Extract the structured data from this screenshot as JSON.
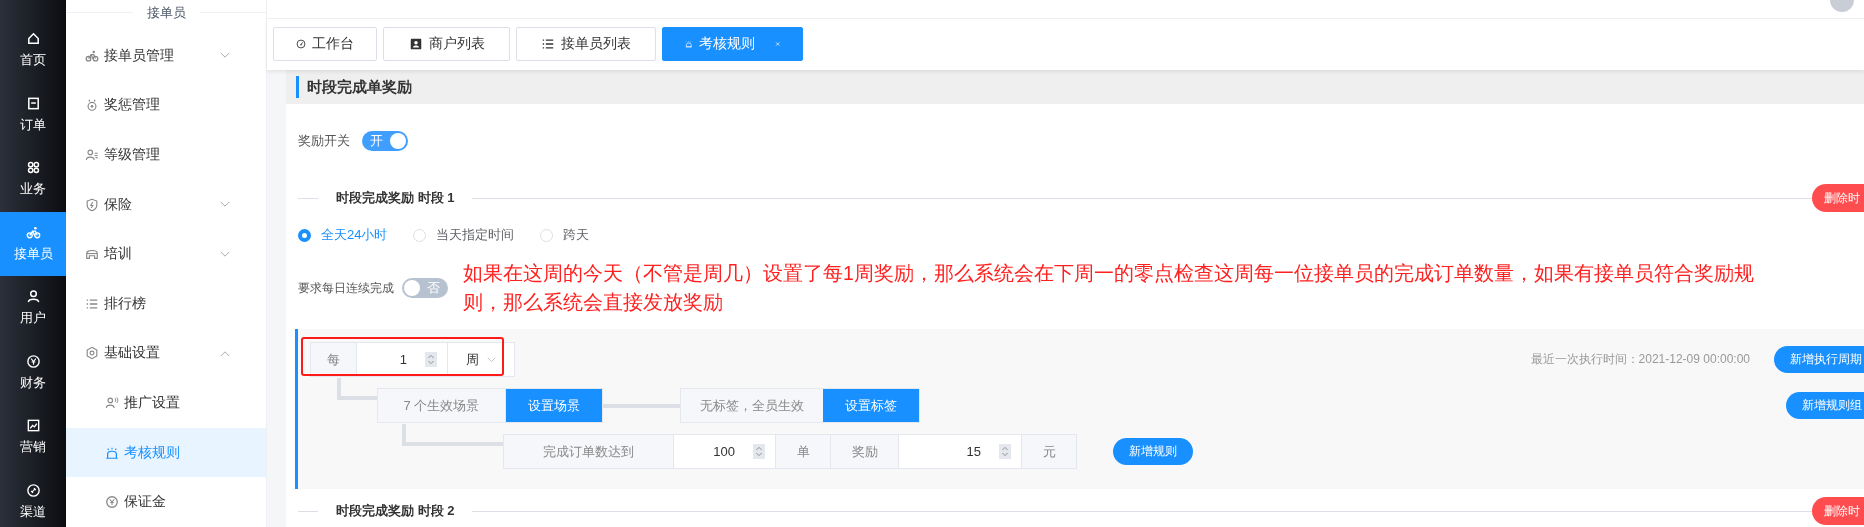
{
  "rail": [
    {
      "label": "首页",
      "selected": false
    },
    {
      "label": "订单",
      "selected": false
    },
    {
      "label": "业务",
      "selected": false
    },
    {
      "label": "接单员",
      "selected": true
    },
    {
      "label": "用户",
      "selected": false
    },
    {
      "label": "财务",
      "selected": false
    },
    {
      "label": "营销",
      "selected": false
    },
    {
      "label": "渠道",
      "selected": false
    }
  ],
  "menu": {
    "title": "接单员",
    "items": [
      {
        "label": "接单员管理",
        "selected": false,
        "expanded": false
      },
      {
        "label": "奖惩管理",
        "selected": false
      },
      {
        "label": "等级管理",
        "selected": false
      },
      {
        "label": "保险",
        "selected": false,
        "expanded": false
      },
      {
        "label": "培训",
        "selected": false,
        "expanded": false
      },
      {
        "label": "排行榜",
        "selected": false
      },
      {
        "label": "基础设置",
        "selected": false,
        "expanded": true,
        "children": [
          {
            "label": "推广设置",
            "selected": false
          },
          {
            "label": "考核规则",
            "selected": true
          },
          {
            "label": "保证金",
            "selected": false
          }
        ]
      }
    ]
  },
  "tabs": [
    {
      "label": "工作台",
      "selected": false
    },
    {
      "label": "商户列表",
      "selected": false
    },
    {
      "label": "接单员列表",
      "selected": false
    },
    {
      "label": "考核规则",
      "selected": true
    }
  ],
  "section": {
    "title": "时段完成单奖励",
    "reward_switch": {
      "label": "奖励开关",
      "on": true,
      "text": "开"
    },
    "periods": [
      {
        "title": "时段完成奖励 时段 1",
        "delete_button": "删除时",
        "modes": [
          {
            "label": "全天24小时",
            "selected": true
          },
          {
            "label": "当天指定时间",
            "selected": false
          },
          {
            "label": "跨天",
            "selected": false
          }
        ],
        "daily_switch": {
          "label": "要求每日连续完成",
          "on": false,
          "text": "否"
        },
        "annotation": "如果在这周的今天（不管是周几）设置了每1周奖励，那么系统会在下周一的零点检查这周每一位接单员的完成订单数量，如果有接单员符合奖励规则，那么系统会直接发放奖励",
        "rule_card": {
          "every_label": "每",
          "every_value": "1",
          "unit": "周",
          "last_run": "最近一次执行时间：2021-12-09 00:00:00",
          "add_cycle_button": "新增执行周期",
          "add_group_button": "新增规则组",
          "scenes_text": "7 个生效场景",
          "scenes_button": "设置场景",
          "tags_text": "无标签，全员生效",
          "tags_button": "设置标签",
          "rule": {
            "prefix": "完成订单数达到",
            "count": "100",
            "count_unit": "单",
            "reward_label": "奖励",
            "reward": "15",
            "reward_unit": "元"
          },
          "add_rule_button": "新增规则"
        }
      },
      {
        "title": "时段完成奖励 时段 2",
        "delete_button": "删除时"
      }
    ]
  }
}
